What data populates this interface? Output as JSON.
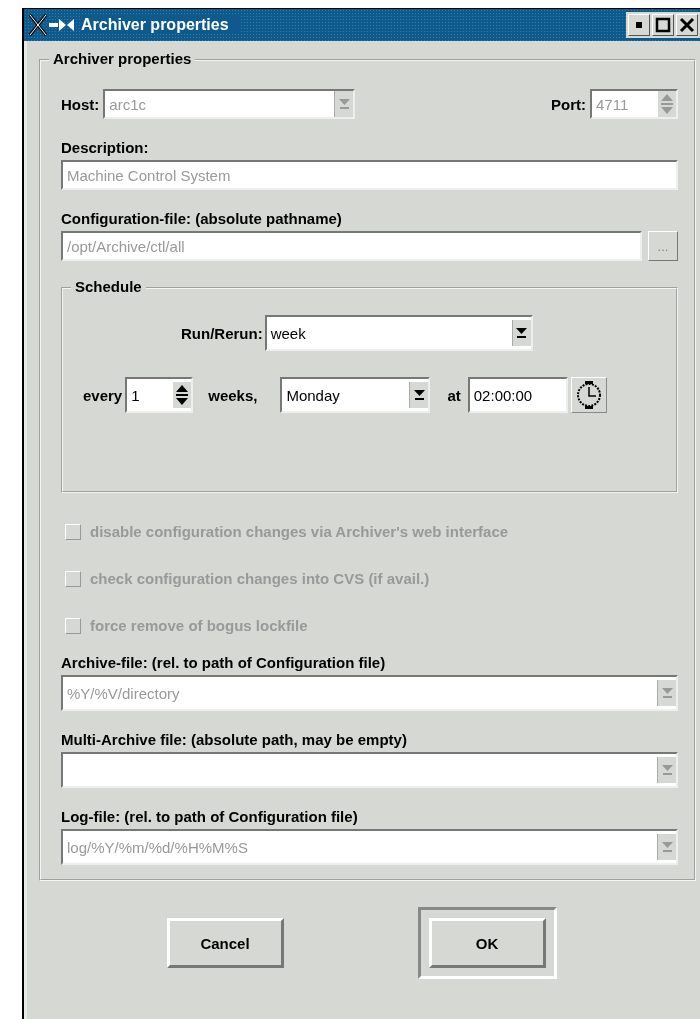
{
  "window": {
    "title": "Archiver properties"
  },
  "group": {
    "title": "Archiver properties"
  },
  "host": {
    "label": "Host:",
    "value": "arc1c",
    "disabled": true
  },
  "port": {
    "label": "Port:",
    "value": "4711",
    "disabled": true
  },
  "description": {
    "label": "Description:",
    "value": "Machine Control System",
    "disabled": true
  },
  "config_file": {
    "label": "Configuration-file: (absolute pathname)",
    "value": "/opt/Archive/ctl/all",
    "disabled": true,
    "browse_button": "..."
  },
  "schedule": {
    "title": "Schedule",
    "run_label": "Run/Rerun:",
    "run_value": "week",
    "every_label": "every",
    "count": "1",
    "unit_label": "weeks,",
    "day": "Monday",
    "at_label": "at",
    "time": "02:00:00"
  },
  "checkboxes": [
    {
      "label": "disable configuration changes via Archiver's web interface",
      "checked": false,
      "disabled": true
    },
    {
      "label": "check configuration changes into CVS (if avail.)",
      "checked": false,
      "disabled": true
    },
    {
      "label": "force remove of bogus lockfile",
      "checked": false,
      "disabled": true
    }
  ],
  "file_fields": [
    {
      "label": "Archive-file: (rel. to path of Configuration file)",
      "value": "%Y/%V/directory",
      "disabled": true
    },
    {
      "label": "Multi-Archive file: (absolute path, may be empty)",
      "disabled": true
    },
    {
      "label": "Log-file: (rel. to path of Configuration file)",
      "value": "log/%Y/%m/%d/%H%M%S",
      "disabled": true
    }
  ],
  "buttons": [
    {
      "label": "Cancel",
      "default": false
    },
    {
      "label": "OK",
      "default": true
    }
  ]
}
